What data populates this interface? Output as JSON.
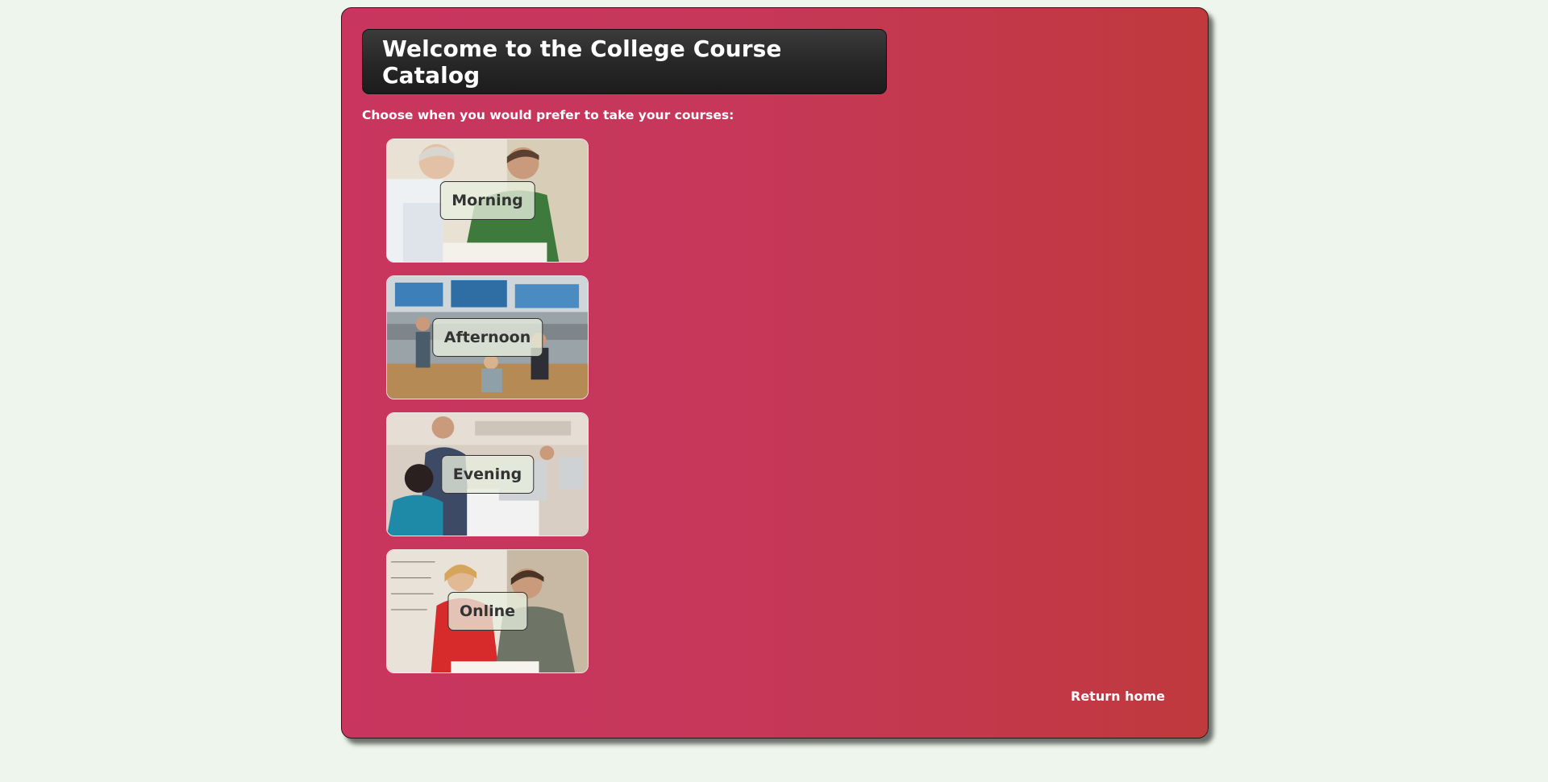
{
  "header": {
    "title": "Welcome to the College Course Catalog"
  },
  "prompt": "Choose when you would prefer to take your courses:",
  "options": [
    {
      "label": "Morning"
    },
    {
      "label": "Afternoon"
    },
    {
      "label": "Evening"
    },
    {
      "label": "Online"
    }
  ],
  "footer": {
    "return_label": "Return home"
  },
  "colors": {
    "page_background": "#eef5ec",
    "panel_gradient_start": "#c8365f",
    "panel_gradient_end": "#c0393c",
    "title_box": "#262626"
  }
}
